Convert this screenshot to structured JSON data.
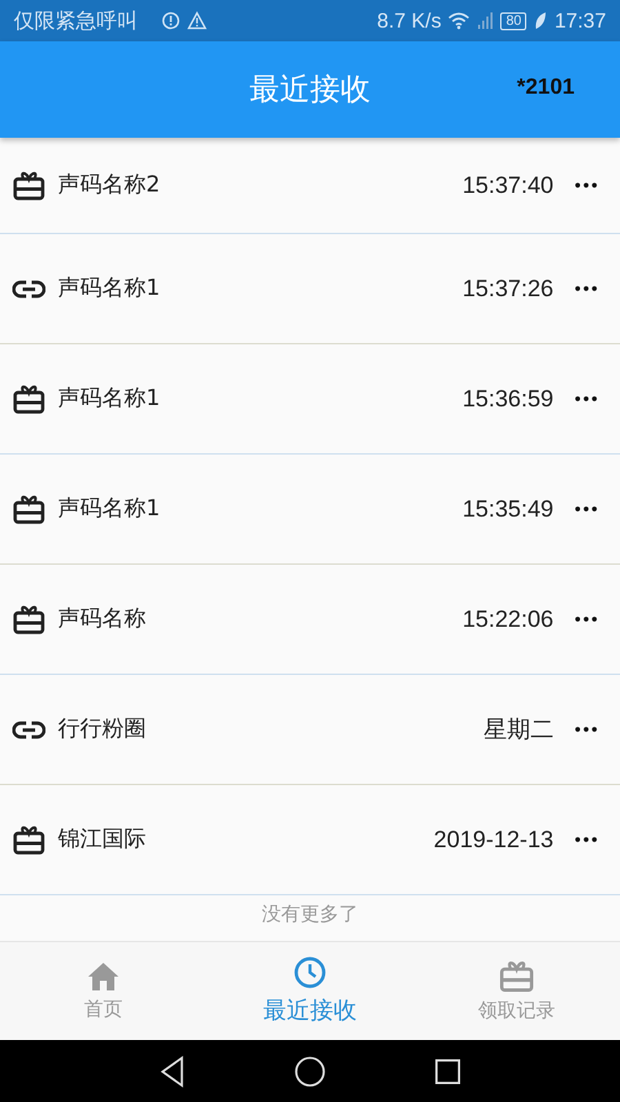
{
  "status_bar": {
    "carrier": "仅限紧急呼叫",
    "speed": "8.7 K/s",
    "battery": "80",
    "time": "17:37"
  },
  "app_bar": {
    "title": "最近接收",
    "account": "*2101"
  },
  "rows": [
    {
      "kind": "gift",
      "name": "声码名称2",
      "time": "15:37:40",
      "more": "•••"
    },
    {
      "kind": "link",
      "name": "声码名称1",
      "time": "15:37:26",
      "more": "•••"
    },
    {
      "kind": "gift",
      "name": "声码名称1",
      "time": "15:36:59",
      "more": "•••"
    },
    {
      "kind": "gift",
      "name": "声码名称1",
      "time": "15:35:49",
      "more": "•••"
    },
    {
      "kind": "gift",
      "name": "声码名称",
      "time": "15:22:06",
      "more": "•••"
    },
    {
      "kind": "link",
      "name": "行行粉圈",
      "time": "星期二",
      "more": "•••"
    },
    {
      "kind": "gift",
      "name": "锦江国际",
      "time": "2019-12-13",
      "more": "•••"
    }
  ],
  "list_end": "没有更多了",
  "tabs": [
    {
      "kind": "home",
      "label": "首页",
      "selected": false
    },
    {
      "kind": "clock",
      "label": "最近接收",
      "selected": true
    },
    {
      "kind": "gift",
      "label": "领取记录",
      "selected": false
    }
  ]
}
